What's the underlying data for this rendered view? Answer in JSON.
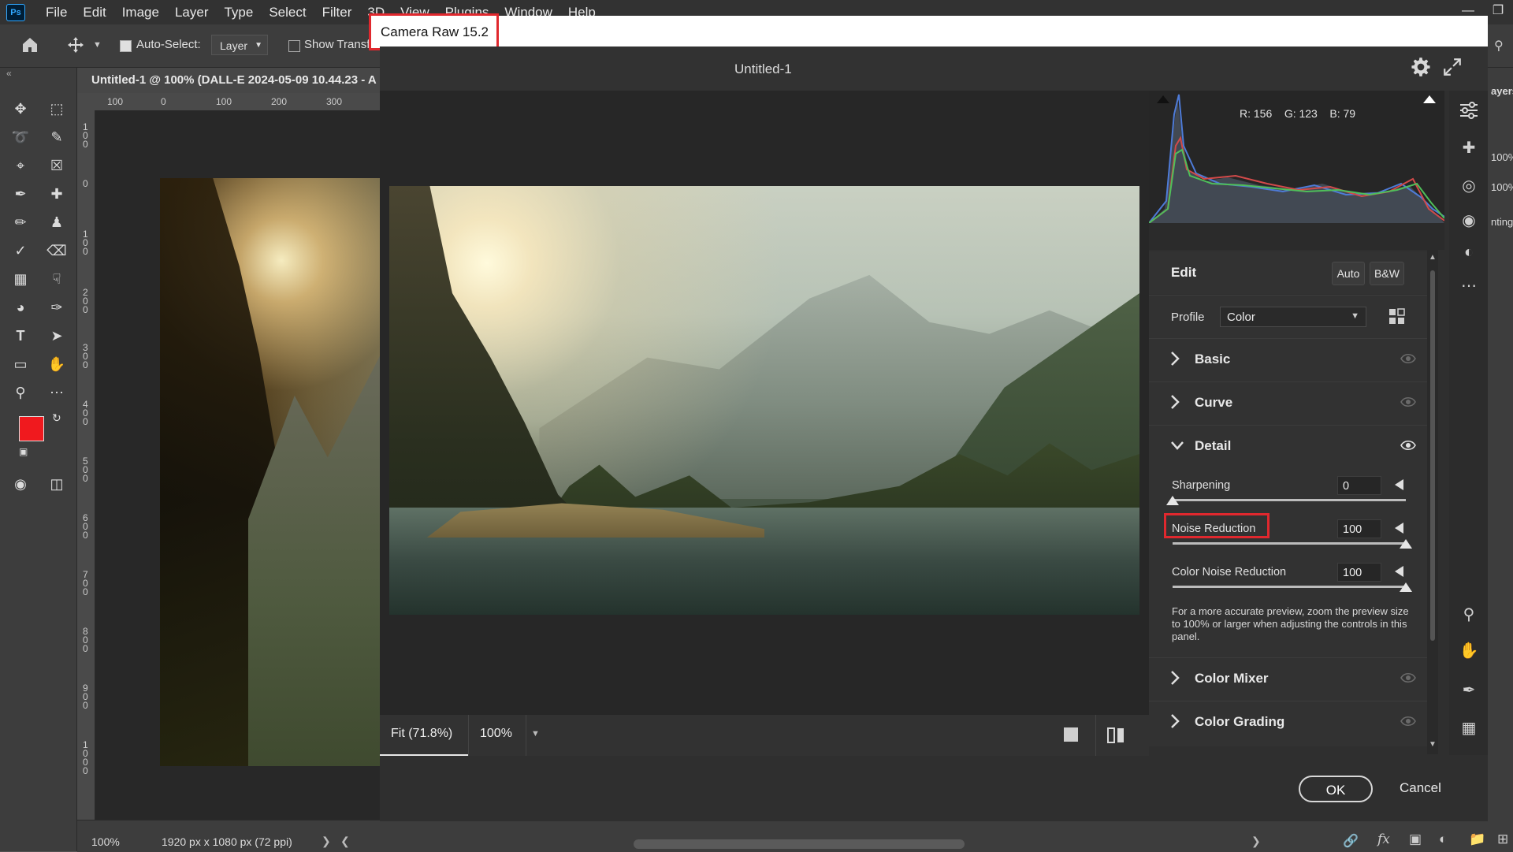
{
  "app": {
    "logo": "Ps",
    "menu": [
      "File",
      "Edit",
      "Image",
      "Layer",
      "Type",
      "Select",
      "Filter",
      "3D",
      "View",
      "Plugins",
      "Window",
      "Help"
    ]
  },
  "options_bar": {
    "auto_select_label": "Auto-Select:",
    "auto_select_checked": true,
    "layer_dropdown_value": "Layer",
    "show_transform_label": "Show Transfor"
  },
  "document": {
    "tab_title": "Untitled-1 @ 100% (DALL-E 2024-05-09 10.44.23 - A",
    "ruler_h_ticks": [
      "100",
      "0",
      "100",
      "200",
      "300"
    ],
    "ruler_v_ticks": [
      "1\n0\n0",
      "0",
      "1\n0\n0",
      "2\n0\n0",
      "3\n0\n0",
      "4\n0\n0",
      "5\n0\n0",
      "6\n0\n0",
      "7\n0\n0",
      "8\n0\n0",
      "9\n0\n0",
      "1\n0\n0\n0"
    ],
    "foreground_color": "#f0191e",
    "background_color": "#ffffff"
  },
  "status_bar": {
    "zoom": "100%",
    "dimensions": "1920 px x 1080 px (72 ppi)"
  },
  "right_dock": {
    "labels": [
      "ayers",
      "100%",
      "100%",
      "nting"
    ]
  },
  "camera_raw": {
    "window_title": "Camera Raw 15.2",
    "document_name": "Untitled-1",
    "rgb": {
      "r": "R: 156",
      "g": "G: 123",
      "b": "B: 79"
    },
    "edit_label": "Edit",
    "auto_label": "Auto",
    "bw_label": "B&W",
    "profile_label": "Profile",
    "profile_value": "Color",
    "sections_collapsed_top": [
      "Basic",
      "Curve"
    ],
    "detail": {
      "title": "Detail",
      "sharpening_label": "Sharpening",
      "sharpening_value": "0",
      "sharpening_level": 0,
      "noise_label": "Noise Reduction",
      "noise_value": "100",
      "noise_level": 1,
      "color_noise_label": "Color Noise Reduction",
      "color_noise_value": "100",
      "color_noise_level": 1,
      "hint": "For a more accurate preview, zoom the preview size to 100% or larger when adjusting the controls in this panel."
    },
    "sections_collapsed_bottom": [
      "Color Mixer",
      "Color Grading"
    ],
    "zoom_fit_label": "Fit (71.8%)",
    "zoom_100_label": "100%",
    "ok_label": "OK",
    "cancel_label": "Cancel",
    "highlight_color": "#e0282e"
  }
}
